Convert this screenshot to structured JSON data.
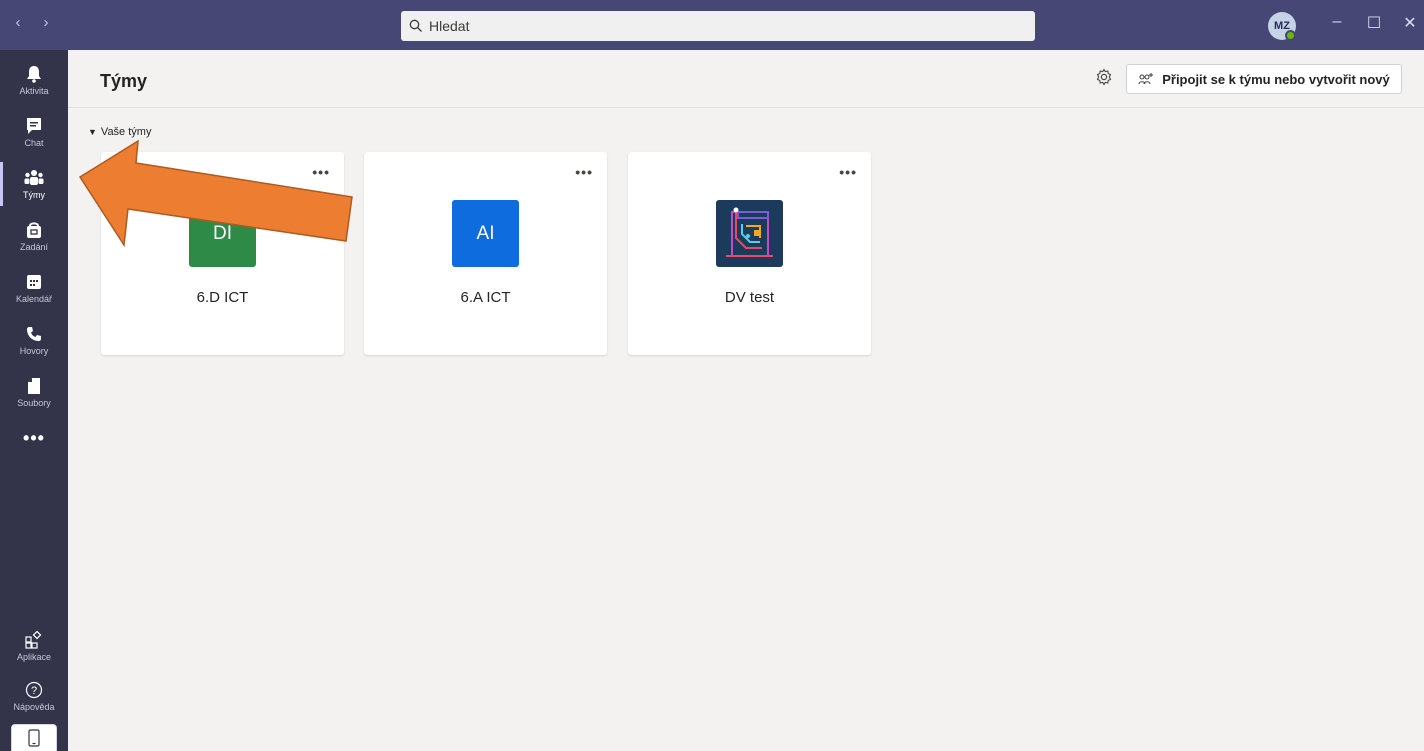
{
  "titlebar": {
    "back_label": "‹",
    "forward_label": "›",
    "search_placeholder": "Hledat",
    "avatar_initials": "MZ",
    "minimize_label": "–",
    "maximize_label": "☐",
    "close_label": "✕"
  },
  "rail": {
    "items": [
      {
        "label": "Aktivita",
        "icon": "bell-icon"
      },
      {
        "label": "Chat",
        "icon": "chat-icon"
      },
      {
        "label": "Týmy",
        "icon": "teams-icon"
      },
      {
        "label": "Zadání",
        "icon": "assignments-icon"
      },
      {
        "label": "Kalendář",
        "icon": "calendar-icon"
      },
      {
        "label": "Hovory",
        "icon": "phone-icon"
      },
      {
        "label": "Soubory",
        "icon": "file-icon"
      }
    ],
    "more_label": "•••",
    "apps_label": "Aplikace",
    "help_label": "Nápověda"
  },
  "header": {
    "title": "Týmy",
    "join_button_label": "Připojit se k týmu nebo vytvořit nový"
  },
  "section": {
    "label": "Vaše týmy"
  },
  "teams": [
    {
      "name": "6.D ICT",
      "initials": "DI",
      "color": "#2e8b47"
    },
    {
      "name": "6.A ICT",
      "initials": "AI",
      "color": "#0f6cdf"
    },
    {
      "name": "DV test",
      "initials": "",
      "color": "#1b3a5c"
    }
  ],
  "card_more_label": "•••",
  "colors": {
    "titlebar": "#464775",
    "rail": "#33344a",
    "annotation_arrow": "#ed7d31"
  }
}
